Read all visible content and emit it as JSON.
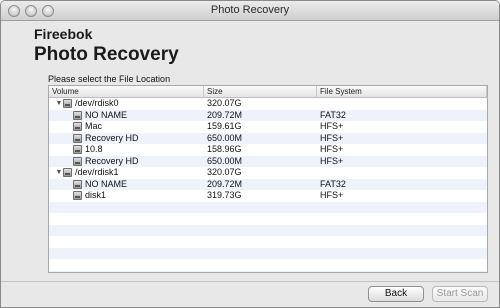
{
  "window": {
    "title": "Photo Recovery"
  },
  "header": {
    "brand": "Fireebok",
    "product": "Photo Recovery"
  },
  "prompt": "Please select the File Location",
  "table": {
    "columns": {
      "volume": "Volume",
      "size": "Size",
      "filesystem": "File System"
    },
    "rows": [
      {
        "name": "/dev/rdisk0",
        "size": "320.07G",
        "fs": ""
      },
      {
        "name": "NO NAME",
        "size": "209.72M",
        "fs": "FAT32"
      },
      {
        "name": "Mac",
        "size": "159.61G",
        "fs": "HFS+"
      },
      {
        "name": "Recovery HD",
        "size": "650.00M",
        "fs": "HFS+"
      },
      {
        "name": "10.8",
        "size": "158.96G",
        "fs": "HFS+"
      },
      {
        "name": "Recovery HD",
        "size": "650.00M",
        "fs": "HFS+"
      },
      {
        "name": "/dev/rdisk1",
        "size": "320.07G",
        "fs": ""
      },
      {
        "name": "NO NAME",
        "size": "209.72M",
        "fs": "FAT32"
      },
      {
        "name": "disk1",
        "size": "319.73G",
        "fs": "HFS+"
      }
    ]
  },
  "buttons": {
    "back": "Back",
    "start": "Start Scan"
  },
  "icons": {
    "expand": "disclosure-triangle-icon",
    "drive": "hard-drive-icon"
  },
  "colors": {
    "alt_row": "#eef3fb"
  }
}
